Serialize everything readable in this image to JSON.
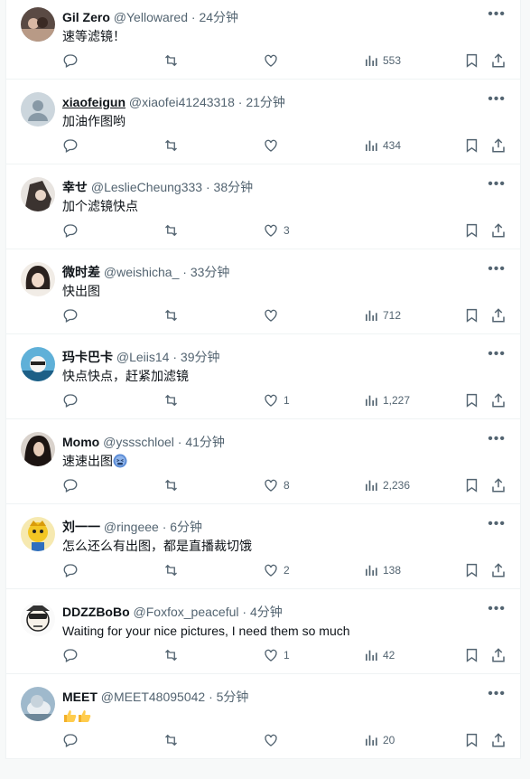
{
  "colors": {
    "text": "#0f1419",
    "secondary": "#536471",
    "border": "#eff3f4",
    "background": "#ffffff"
  },
  "icons": [
    "reply-icon",
    "retweet-icon",
    "like-icon",
    "views-icon",
    "bookmark-icon",
    "share-icon",
    "more-icon"
  ],
  "tweets": [
    {
      "name": "Gil Zero",
      "handle": "@Yellowared",
      "sep": "·",
      "time": "24分钟",
      "text": "速等滤镜！",
      "likes": "",
      "views": "553"
    },
    {
      "name": "xiaofeigun",
      "handle": "@xiaofei41243318",
      "sep": "·",
      "time": "21分钟",
      "text": "加油作图哟",
      "likes": "",
      "views": "434"
    },
    {
      "name": "幸せ",
      "handle": "@LeslieCheung333",
      "sep": "·",
      "time": "38分钟",
      "text": "加个滤镜快点",
      "likes": "3",
      "views": ""
    },
    {
      "name": "微时差",
      "handle": "@weishicha_",
      "sep": "·",
      "time": "33分钟",
      "text": "快出图",
      "likes": "",
      "views": "712"
    },
    {
      "name": "玛卡巴卡",
      "handle": "@Leiis14",
      "sep": "·",
      "time": "39分钟",
      "text": "快点快点，赶紧加滤镜",
      "likes": "1",
      "views": "1,227"
    },
    {
      "name": "Momo",
      "handle": "@yssschloel",
      "sep": "·",
      "time": "41分钟",
      "text": "速速出图",
      "likes": "8",
      "views": "2,236"
    },
    {
      "name": "刘一一",
      "handle": "@ringeee",
      "sep": "·",
      "time": "6分钟",
      "text": "怎么还么有出图，都是直播裁切饿",
      "likes": "2",
      "views": "138"
    },
    {
      "name": "DDZZBoBo",
      "handle": "@Foxfox_peaceful",
      "sep": "·",
      "time": "4分钟",
      "text": "Waiting for your nice pictures, I need them so much",
      "likes": "1",
      "views": "42"
    },
    {
      "name": "MEET",
      "handle": "@MEET48095042",
      "sep": "·",
      "time": "5分钟",
      "text": "",
      "likes": "",
      "views": "20"
    }
  ]
}
